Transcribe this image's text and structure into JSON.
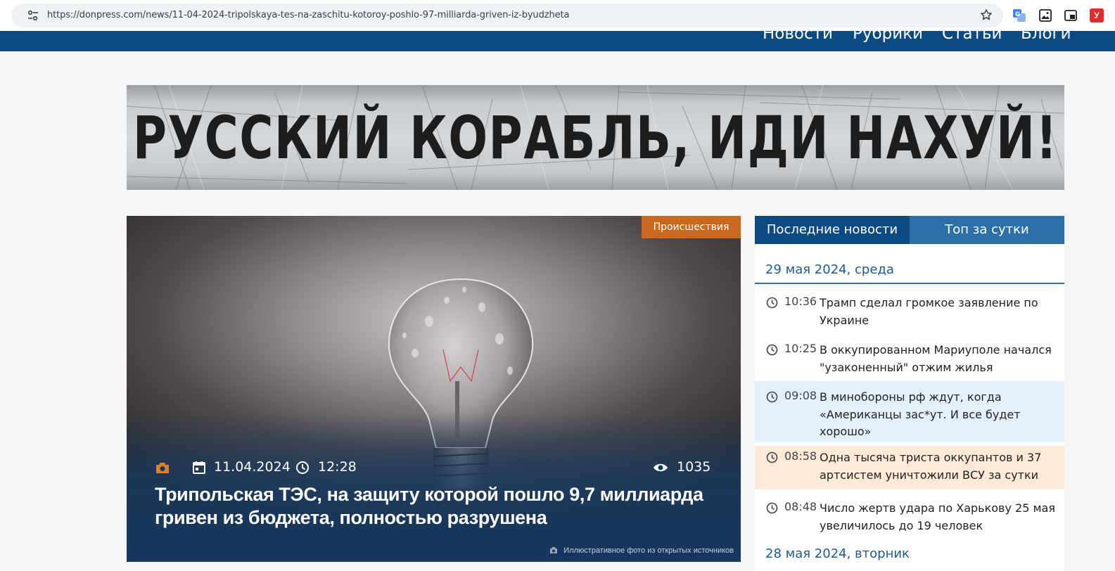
{
  "browser": {
    "url": "https://donpress.com/news/11-04-2024-tripolskaya-tes-na-zaschitu-kotoroy-poshlo-97-milliarda-griven-iz-byudzheta",
    "extension_red_label": "У"
  },
  "nav": {
    "items": [
      "Новости",
      "Рубрики",
      "Статьи",
      "Блоги"
    ]
  },
  "banner": {
    "text": "РУССКИЙ КОРАБЛЬ, ИДИ НАХУЙ!"
  },
  "article": {
    "category": "Происшествия",
    "date": "11.04.2024",
    "time": "12:28",
    "views": "1035",
    "title": "Трипольская ТЭС, на защиту которой пошло 9,7 миллиарда гривен из бюджета, полностью разрушена",
    "photo_note": "Иллюстративное фото из открытых источников"
  },
  "sidebar": {
    "tabs": [
      "Последние новости",
      "Топ за сутки"
    ],
    "day1": "29 мая 2024, среда",
    "day2": "28 мая 2024, вторник",
    "items": [
      {
        "time": "10:36",
        "text": "Трамп сделал громкое заявление по Украине"
      },
      {
        "time": "10:25",
        "text": "В оккупированном Мариуполе начался \"узаконенный\" отжим жилья"
      },
      {
        "time": "09:08",
        "text": "В минобороны рф ждут, когда «Американцы зас*ут. И все будет хорошо»"
      },
      {
        "time": "08:58",
        "text": "Одна тысяча триста оккупантов и 37 артсистем уничтожили ВСУ за сутки"
      },
      {
        "time": "08:48",
        "text": "Число жертв удара по Харькову 25 мая увеличилось до 19 человек"
      }
    ]
  },
  "colors": {
    "nav_blue": "#0d4a84",
    "tab_blue": "#2d6fa9",
    "badge_orange": "#c8691f",
    "highlight_blue": "#e3f0fc",
    "highlight_orange": "#fde9d8"
  }
}
